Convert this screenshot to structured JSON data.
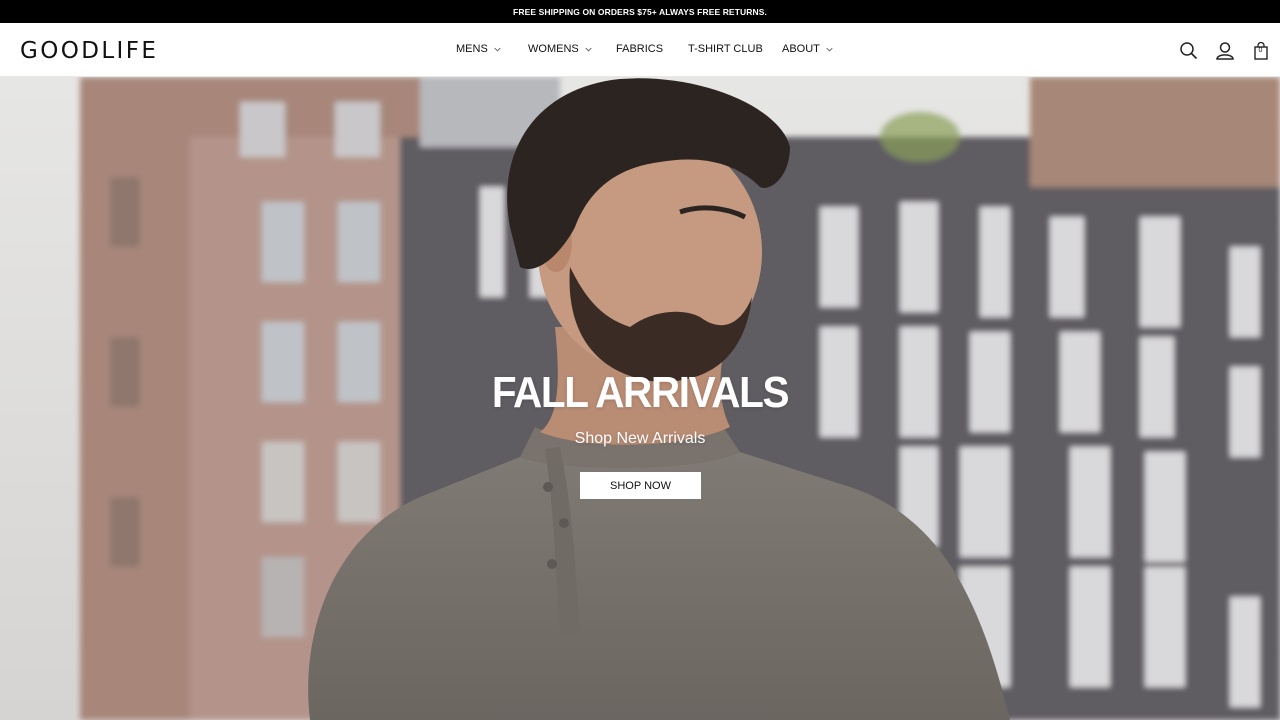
{
  "announcement": "FREE SHIPPING ON ORDERS $75+ ALWAYS FREE RETURNS.",
  "brand": {
    "logo_text": "GOODLIFE"
  },
  "nav": [
    {
      "label": "MENS",
      "has_dropdown": true
    },
    {
      "label": "WOMENS",
      "has_dropdown": true
    },
    {
      "label": "FABRICS",
      "has_dropdown": false
    },
    {
      "label": "T-SHIRT CLUB",
      "has_dropdown": false
    },
    {
      "label": "ABOUT",
      "has_dropdown": true
    }
  ],
  "header_icons": [
    "search-icon",
    "account-icon",
    "cart-icon"
  ],
  "cart": {
    "count": "0"
  },
  "hero": {
    "title": "FALL ARRIVALS",
    "subtitle": "Shop New Arrivals",
    "cta_label": "SHOP NOW"
  },
  "colors": {
    "announcement_bg": "#000000",
    "header_bg": "#ffffff",
    "cta_bg": "#ffffff",
    "hero_text": "#ffffff"
  }
}
